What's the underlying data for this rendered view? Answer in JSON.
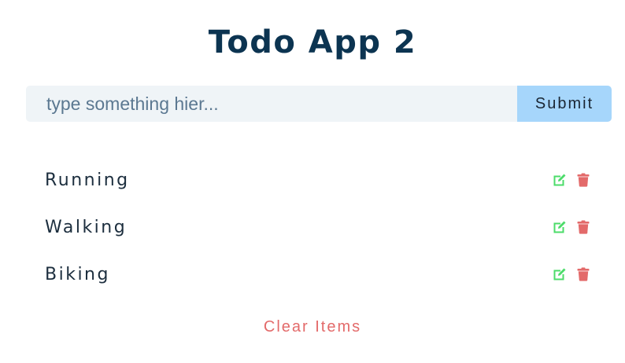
{
  "app": {
    "title": "Todo App 2"
  },
  "form": {
    "placeholder": "type something hier...",
    "value": "",
    "submit_label": "Submit"
  },
  "items": [
    {
      "label": "Running",
      "edit_icon": "edit-icon",
      "delete_icon": "trash-icon"
    },
    {
      "label": "Walking",
      "edit_icon": "edit-icon",
      "delete_icon": "trash-icon"
    },
    {
      "label": "Biking",
      "edit_icon": "edit-icon",
      "delete_icon": "trash-icon"
    }
  ],
  "clear": {
    "label": "Clear Items"
  },
  "colors": {
    "title": "#0c3451",
    "input_bg": "#eff4f7",
    "submit_bg": "#a6d6fb",
    "edit": "#4cdc6a",
    "delete": "#e36a6a",
    "clear": "#e36a6a"
  }
}
